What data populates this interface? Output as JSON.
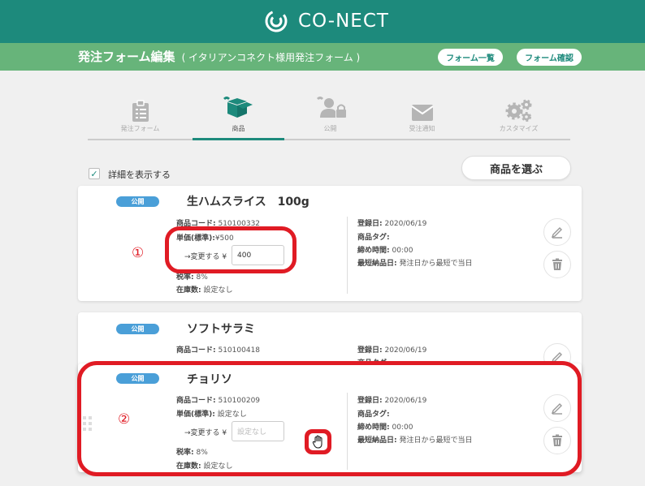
{
  "header": {
    "logo_text": "CO-NECT"
  },
  "subbar": {
    "title": "発注フォーム編集",
    "subtitle": "( イタリアンコネクト様用発注フォーム )",
    "form_list_label": "フォーム一覧",
    "form_confirm_label": "フォーム確認"
  },
  "steps": [
    {
      "label": "発注フォーム",
      "icon": "clipboard-icon",
      "active": false
    },
    {
      "label": "商品",
      "icon": "box-icon",
      "active": true
    },
    {
      "label": "公開",
      "icon": "user-lock-icon",
      "active": false
    },
    {
      "label": "受注通知",
      "icon": "mail-icon",
      "active": false
    },
    {
      "label": "カスタマイズ",
      "icon": "gears-icon",
      "active": false
    }
  ],
  "toolbar": {
    "show_details_label": "詳細を表示する",
    "show_details_checked": true,
    "select_products_label": "商品を選ぶ"
  },
  "labels": {
    "code": "商品コード:",
    "price": "単価(標準):",
    "change": "→変更する ¥",
    "tax": "税率:",
    "stock": "在庫数:",
    "registered": "登録日:",
    "tag": "商品タグ:",
    "cutoff": "締め時間:",
    "delivery": "最短納品日:"
  },
  "products": [
    {
      "badge": "公開",
      "name": "生ハムスライス　100g",
      "code": "510100332",
      "price": "¥500",
      "change_value": "400",
      "tax": "8%",
      "stock": "設定なし",
      "registered": "2020/06/19",
      "tag": "",
      "cutoff": "00:00",
      "delivery": "発注日から最短で当日"
    },
    {
      "badge": "公開",
      "name": "ソフトサラミ",
      "code": "510100418",
      "registered": "2020/06/19",
      "tag": ""
    },
    {
      "badge": "公開",
      "name": "チョリソ",
      "code": "510100209",
      "price": "設定なし",
      "change_placeholder": "設定なし",
      "tax": "8%",
      "stock": "設定なし",
      "registered": "2020/06/19",
      "tag": "",
      "cutoff": "00:00",
      "delivery": "発注日から最短で当日"
    }
  ],
  "annotations": {
    "one": "①",
    "two": "②"
  },
  "colors": {
    "brand_teal": "#1d8a7c",
    "subbar_green": "#67b47a",
    "badge_blue": "#4a9fd8",
    "annotation_red": "#e01b24"
  }
}
